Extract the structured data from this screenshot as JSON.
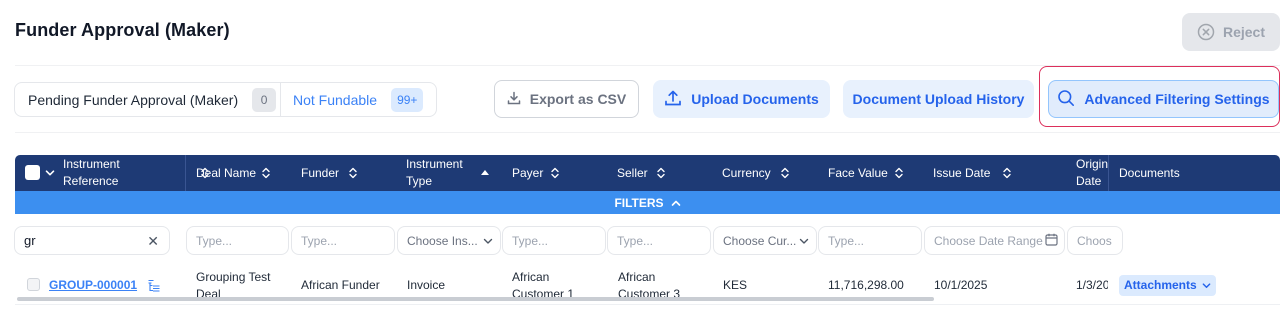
{
  "header": {
    "title": "Funder Approval (Maker)",
    "reject_label": "Reject"
  },
  "tabs": [
    {
      "label": "Pending Funder Approval (Maker)",
      "count": "0"
    },
    {
      "label": "Not Fundable",
      "count": "99+"
    }
  ],
  "toolbar": {
    "export_label": "Export as CSV",
    "upload_label": "Upload Documents",
    "history_label": "Document Upload History",
    "advanced_label": "Advanced Filtering Settings"
  },
  "table": {
    "columns": {
      "instrument_reference": "Instrument Reference",
      "deal_name": "Deal Name",
      "funder": "Funder",
      "instrument_type": "Instrument Type",
      "payer": "Payer",
      "seller": "Seller",
      "currency": "Currency",
      "face_value": "Face Value",
      "issue_date": "Issue Date",
      "origination_date": "Origin Date",
      "documents": "Documents"
    },
    "filters_label": "FILTERS",
    "filters": {
      "search_value": "gr",
      "type_placeholder": "Type...",
      "choose_instrument": "Choose Ins...",
      "choose_currency": "Choose Cur...",
      "choose_date_range": "Choose Date Range",
      "choose_origin": "Choos"
    },
    "rows": [
      {
        "reference": "GROUP-000001",
        "deal_name": "Grouping Test Deal",
        "funder": "African Funder",
        "instrument_type": "Invoice",
        "payer": "African Customer 1",
        "seller": "African Customer 3",
        "currency": "KES",
        "face_value": "11,716,298.00",
        "issue_date": "10/1/2025",
        "origination_date": "1/3/20",
        "documents": "Attachments"
      }
    ]
  },
  "colors": {
    "header_bg": "#1e3a75",
    "filters_bar": "#3c8ff0",
    "accent": "#2563eb",
    "highlight_border": "#dc2f5b"
  }
}
